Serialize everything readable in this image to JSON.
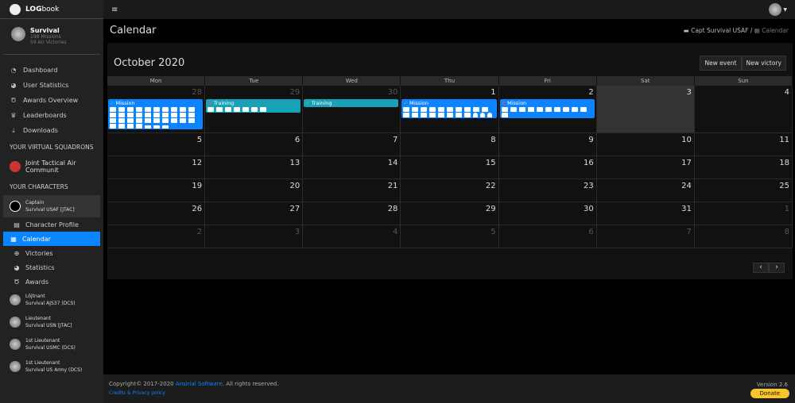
{
  "app": {
    "logo_bold": "LOG",
    "logo_rest": "book"
  },
  "user": {
    "name": "Survival",
    "missions": "198 Missions",
    "victories": "59 Air Victories"
  },
  "nav": [
    {
      "label": "Dashboard",
      "icon": "dashboard-icon",
      "g": "◔"
    },
    {
      "label": "User Statistics",
      "icon": "pie-chart-icon",
      "g": "◕"
    },
    {
      "label": "Awards Overview",
      "icon": "medal-icon",
      "g": "Ծ"
    },
    {
      "label": "Leaderboards",
      "icon": "trophy-icon",
      "g": "♛"
    },
    {
      "label": "Downloads",
      "icon": "download-icon",
      "g": "⤓"
    }
  ],
  "squadrons_heading": "YOUR VIRTUAL SQUADRONS",
  "squadron": "Joint Tactical Air Communit",
  "characters_heading": "YOUR CHARACTERS",
  "active_character": {
    "rank": "Captain",
    "name": "Survival USAF [JTAC]"
  },
  "char_menu": [
    {
      "label": "Character Profile",
      "g": "▤"
    },
    {
      "label": "Calendar",
      "g": "▦"
    },
    {
      "label": "Victories",
      "g": "⊕"
    },
    {
      "label": "Statistics",
      "g": "◕"
    },
    {
      "label": "Awards",
      "g": "Ծ"
    }
  ],
  "other_characters": [
    {
      "rank": "Löjtnant",
      "name": "Survival AJS37 (DCS)"
    },
    {
      "rank": "Lieutenant",
      "name": "Survival USN [JTAC]"
    },
    {
      "rank": "1st Lieutenant",
      "name": "Survival USMC (DCS)"
    },
    {
      "rank": "1st Lieutenant",
      "name": "Survival US Army (DCS)"
    }
  ],
  "page_title": "Calendar",
  "breadcrumb": {
    "parent": "Capt Survival USAF",
    "current": "Calendar",
    "sep": "/"
  },
  "calendar": {
    "month": "October 2020",
    "new_event": "New event",
    "new_victory": "New victory",
    "dow": [
      "Mon",
      "Tue",
      "Wed",
      "Thu",
      "Fri",
      "Sat",
      "Sun"
    ],
    "weeks": [
      [
        "28",
        "29",
        "30",
        "1",
        "2",
        "3",
        "4"
      ],
      [
        "5",
        "6",
        "7",
        "8",
        "9",
        "10",
        "11"
      ],
      [
        "12",
        "13",
        "14",
        "15",
        "16",
        "17",
        "18"
      ],
      [
        "19",
        "20",
        "21",
        "22",
        "23",
        "24",
        "25"
      ],
      [
        "26",
        "27",
        "28",
        "29",
        "30",
        "31",
        "1"
      ],
      [
        "2",
        "3",
        "4",
        "5",
        "6",
        "7",
        "8"
      ]
    ],
    "other_month": [
      [
        0,
        1,
        2
      ],
      [],
      [],
      [],
      [
        6
      ],
      [
        0,
        1,
        2,
        3,
        4,
        5,
        6
      ]
    ],
    "today": [
      0,
      5
    ],
    "events": [
      {
        "day": 0,
        "type": "mission",
        "label": "Mission",
        "status": "ok",
        "trucks": 34,
        "persons": 0,
        "planes": 3
      },
      {
        "day": 1,
        "type": "training",
        "label": "Training",
        "status": "no",
        "trucks": 7,
        "persons": 0,
        "planes": 0
      },
      {
        "day": 2,
        "type": "training",
        "label": "Training",
        "status": "ok",
        "trucks": 0,
        "persons": 0,
        "planes": 0
      },
      {
        "day": 3,
        "type": "mission",
        "label": "Mission",
        "status": "ok",
        "trucks": 18,
        "persons": 3,
        "planes": 0
      },
      {
        "day": 4,
        "type": "mission",
        "label": "Mission",
        "status": "no",
        "trucks": 11,
        "persons": 0,
        "planes": 0
      }
    ],
    "prev": "‹",
    "next": "›"
  },
  "footer": {
    "copy": "Copyright© 2017-2020 ",
    "company": "Ansirial Software",
    "rights": ". All rights reserved.",
    "credits": "Credits & Privacy policy",
    "version": "Version 2.6",
    "donate": "Donate"
  }
}
